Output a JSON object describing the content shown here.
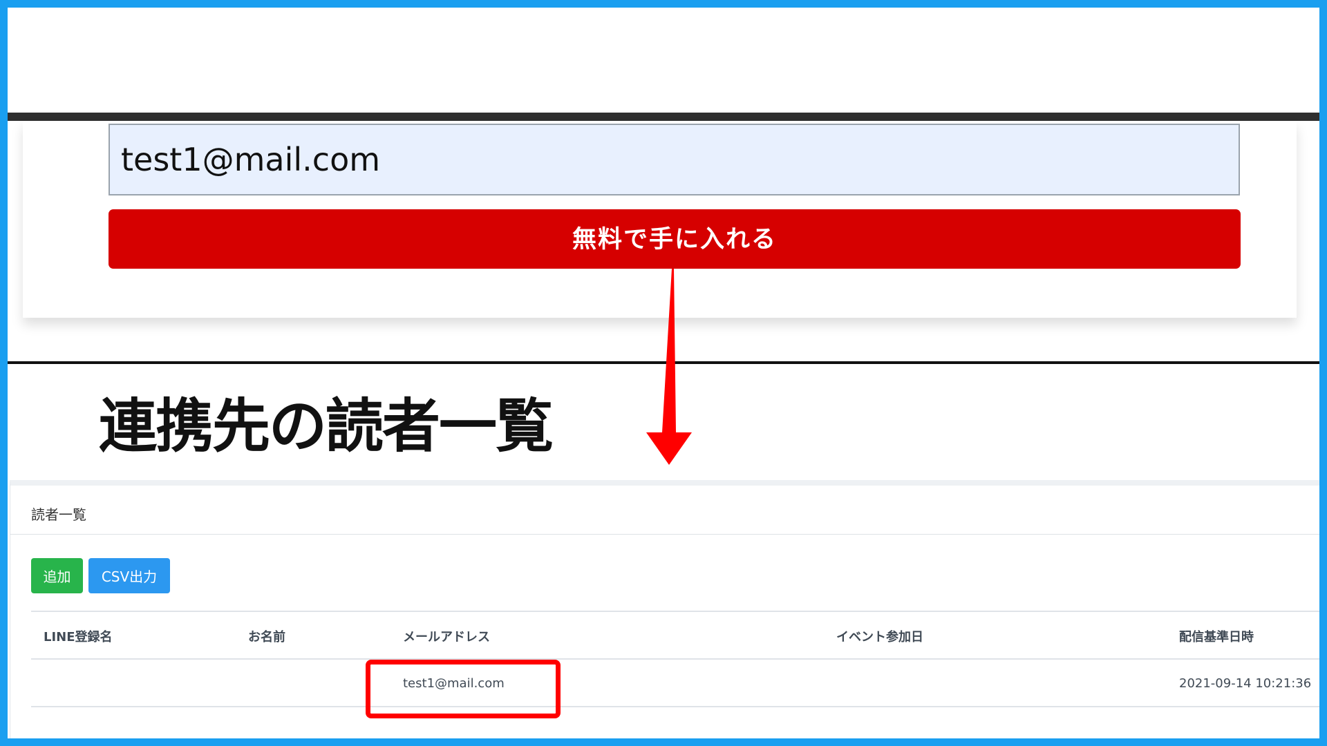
{
  "form": {
    "email_value": "test1@mail.com",
    "submit_label": "無料で手に入れる"
  },
  "annotation": {
    "heading": "連携先の読者一覧",
    "arrow_icon": "down-arrow-icon",
    "arrow_color": "#ff0000",
    "highlight_color": "#ff0000"
  },
  "reader_list": {
    "title": "読者一覧",
    "add_label": "追加",
    "csv_label": "CSV出力",
    "columns": [
      "LINE登録名",
      "お名前",
      "メールアドレス",
      "イベント参加日",
      "配信基準日時"
    ],
    "rows": [
      {
        "line_name": "",
        "name": "",
        "email": "test1@mail.com",
        "event_date": "",
        "delivery_datetime": "2021-09-14 10:21:36"
      }
    ]
  },
  "colors": {
    "frame_border": "#1a9ff0",
    "submit_bg": "#d60000",
    "input_bg": "#e8f0fe",
    "add_button_bg": "#28b44b",
    "csv_button_bg": "#2c98f0"
  }
}
